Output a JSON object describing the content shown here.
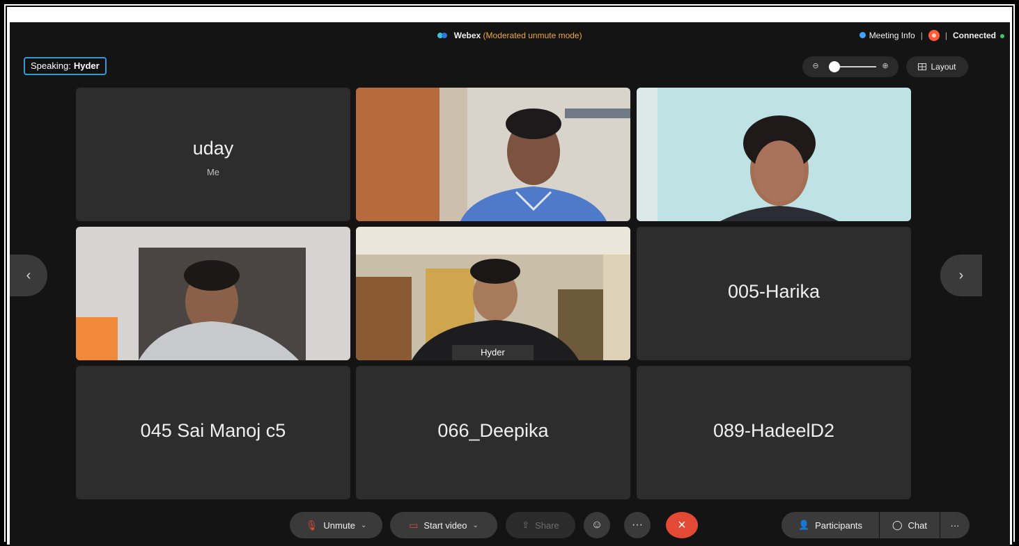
{
  "header": {
    "app_name": "Webex",
    "mode": "(Moderated unmute mode)",
    "meeting_info": "Meeting Info",
    "separator": "|",
    "status": "Connected"
  },
  "speaking": {
    "label": "Speaking:",
    "name": "Hyder"
  },
  "layout_button": "Layout",
  "tiles": [
    {
      "name": "uday",
      "sub": "Me",
      "has_video": false
    },
    {
      "name": "",
      "has_video": true
    },
    {
      "name": "",
      "has_video": true
    },
    {
      "name": "",
      "has_video": true
    },
    {
      "name": "Hyder",
      "has_video": true,
      "active": true
    },
    {
      "name": "005-Harika",
      "has_video": false
    },
    {
      "name": "045 Sai Manoj c5",
      "has_video": false
    },
    {
      "name": "066_Deepika",
      "has_video": false
    },
    {
      "name": "089-HadeelD2",
      "has_video": false
    }
  ],
  "controls": {
    "unmute": "Unmute",
    "start_video": "Start video",
    "share": "Share",
    "participants": "Participants",
    "chat": "Chat"
  },
  "icons": {
    "webex": "webex-logo-icon",
    "mic": "mic-muted-icon",
    "camera": "camera-off-icon",
    "share": "share-icon",
    "reactions": "smiley-icon",
    "more": "more-icon",
    "end": "close-icon",
    "participants": "participants-icon",
    "chat": "chat-icon",
    "zoom_out": "zoom-out-icon",
    "zoom_in": "zoom-in-icon",
    "layout": "grid-icon",
    "prev": "chevron-left-icon",
    "next": "chevron-right-icon"
  },
  "colors": {
    "accent_blue": "#5bb7e6",
    "mode_orange": "#f0a73b",
    "end_red": "#e24a35",
    "connected_green": "#3cc66a"
  }
}
